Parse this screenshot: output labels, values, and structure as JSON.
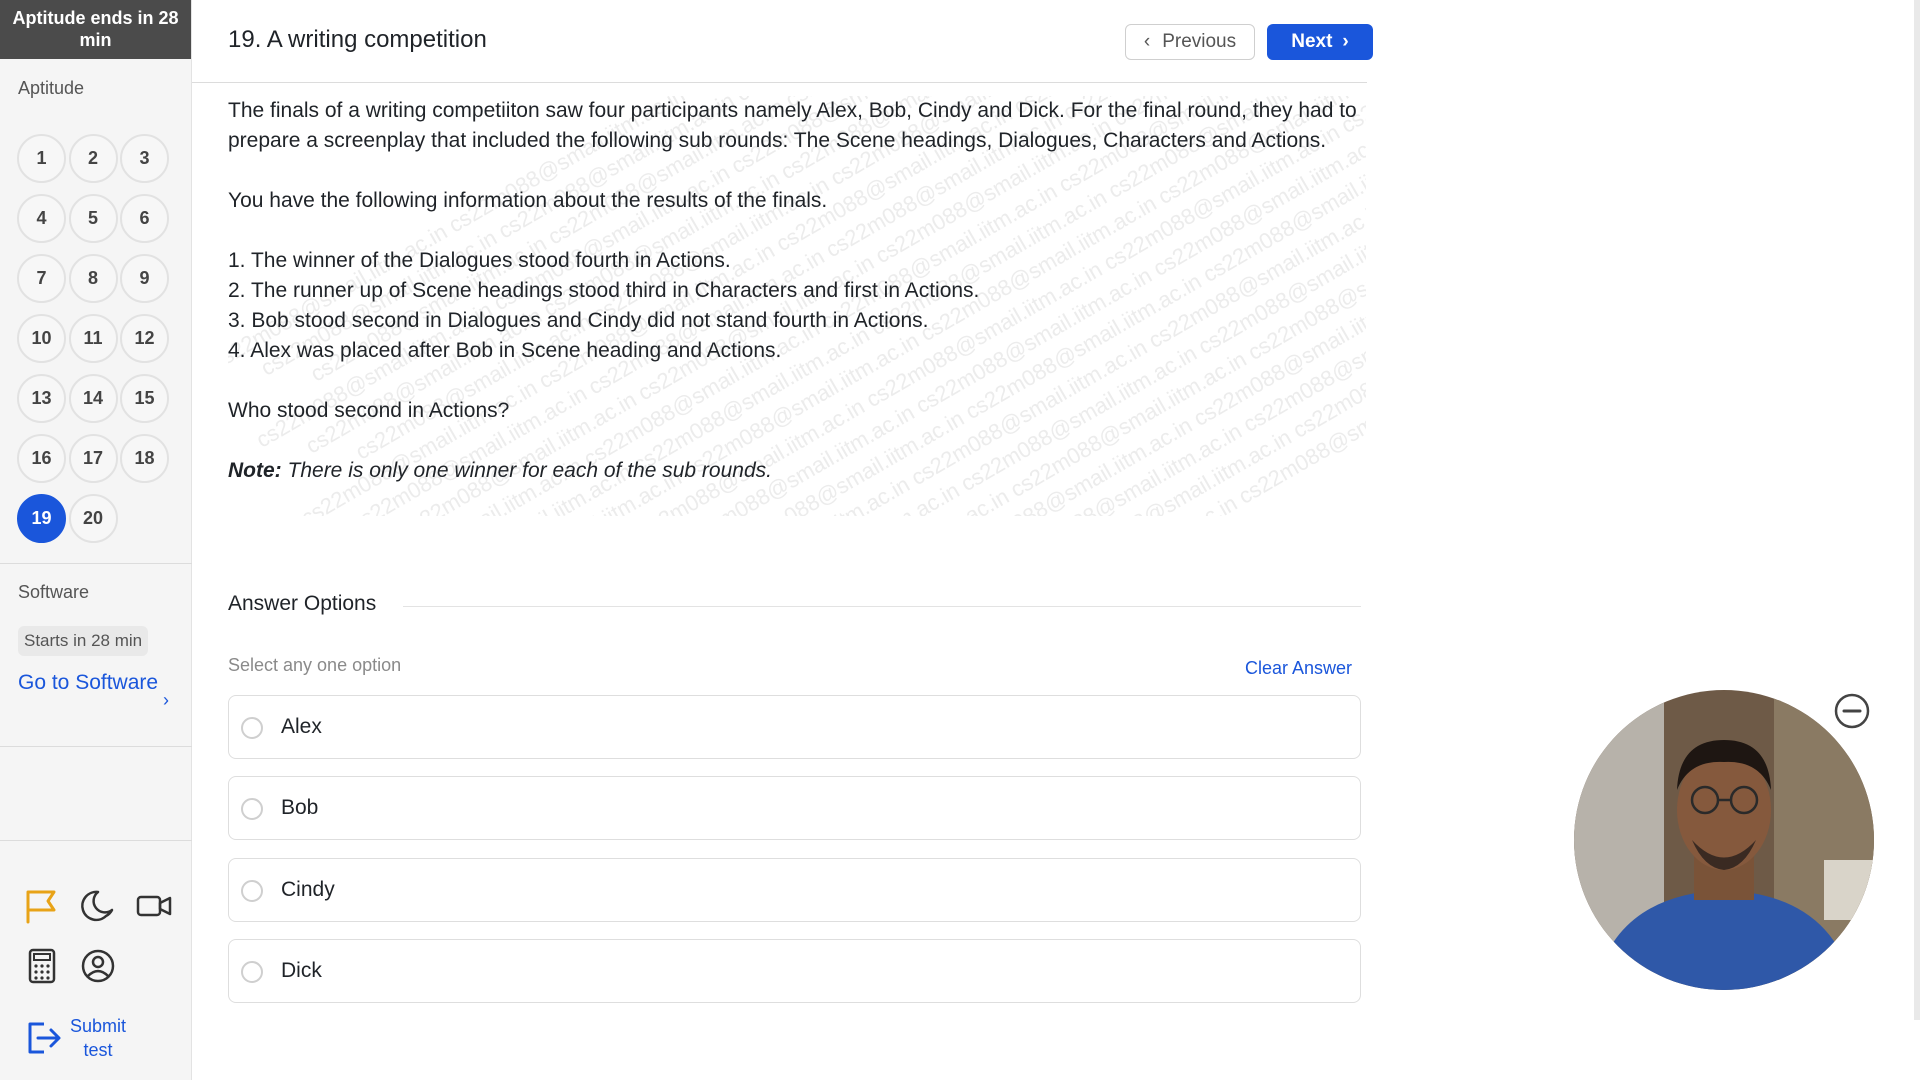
{
  "sidebar": {
    "timer": "Aptitude ends in 28 min",
    "aptitude_title": "Aptitude",
    "questions": [
      "1",
      "2",
      "3",
      "4",
      "5",
      "6",
      "7",
      "8",
      "9",
      "10",
      "11",
      "12",
      "13",
      "14",
      "15",
      "16",
      "17",
      "18",
      "19",
      "20"
    ],
    "active_question": "19",
    "software_title": "Software",
    "starts": "Starts in 28 min",
    "goto_software": "Go to Software",
    "tools": [
      "flag-icon",
      "moon-icon",
      "video-camera-icon",
      "calculator-icon",
      "user-circle-icon"
    ],
    "submit_label_line1": "Submit",
    "submit_label_line2": "test"
  },
  "header": {
    "question_title": "19. A writing competition",
    "previous_label": "Previous",
    "next_label": "Next"
  },
  "question": {
    "para1": "The finals of a writing competiiton saw four participants namely Alex, Bob, Cindy and Dick. For the final round, they had to prepare a screenplay that included the following sub rounds: The Scene headings, Dialogues, Characters and Actions.",
    "para2": "You have the following information about the results of the finals.",
    "clues": [
      "1. The winner of the Dialogues stood fourth in Actions.",
      "2. The runner up of Scene headings stood third in Characters and first in Actions.",
      "3. Bob stood second in Dialogues and Cindy did not stand fourth in Actions.",
      "4. Alex was placed after Bob in Scene heading and Actions."
    ],
    "ask": "Who stood second in Actions?",
    "note_label": "Note:",
    "note_text": " There is only one winner for each of the sub rounds.",
    "watermark": "cs22m088@smail.iitm.ac.in"
  },
  "answers": {
    "heading": "Answer Options",
    "instruction": "Select any one option",
    "clear_label": "Clear Answer",
    "options": [
      "Alex",
      "Bob",
      "Cindy",
      "Dick"
    ]
  },
  "colors": {
    "accent": "#1a56db",
    "timer_bg": "#4b4b4b",
    "flag": "#e8a317"
  }
}
